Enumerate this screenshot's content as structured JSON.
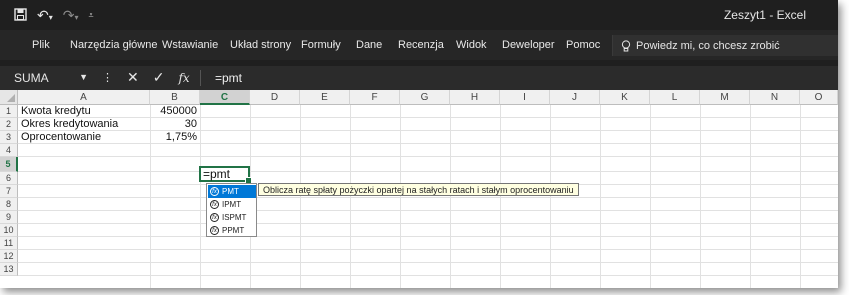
{
  "titlebar": {
    "title": "Zeszyt1  -  Excel"
  },
  "menu": {
    "tabs": [
      "Plik",
      "Narzędzia główne",
      "Wstawianie",
      "Układ strony",
      "Formuły",
      "Dane",
      "Recenzja",
      "Widok",
      "Deweloper",
      "Pomoc"
    ],
    "tellme": "Powiedz mi, co chcesz zrobić"
  },
  "formula_bar": {
    "name_box": "SUMA",
    "formula": "=pmt"
  },
  "columns": [
    "A",
    "B",
    "C",
    "D",
    "E",
    "F",
    "G",
    "H",
    "I",
    "J",
    "K",
    "L",
    "M",
    "N",
    "O"
  ],
  "rows": [
    "1",
    "2",
    "3",
    "4",
    "5",
    "6",
    "7",
    "8",
    "9",
    "10",
    "11",
    "12",
    "13"
  ],
  "cells": {
    "A1": "Kwota kredytu",
    "B1": "450000",
    "A2": "Okres kredytowania",
    "B2": "30",
    "A3": "Oprocentowanie",
    "B3": "1,75%",
    "C5": "=pmt"
  },
  "autocomplete": {
    "items": [
      "PMT",
      "IPMT",
      "ISPMT",
      "PPMT"
    ],
    "selected": "PMT",
    "tooltip": "Oblicza ratę spłaty pożyczki opartej na stałych ratach i stałym oprocentowaniu"
  },
  "colors": {
    "accent": "#217346",
    "titlebar": "#1f1f1f",
    "selection": "#0078d7"
  }
}
